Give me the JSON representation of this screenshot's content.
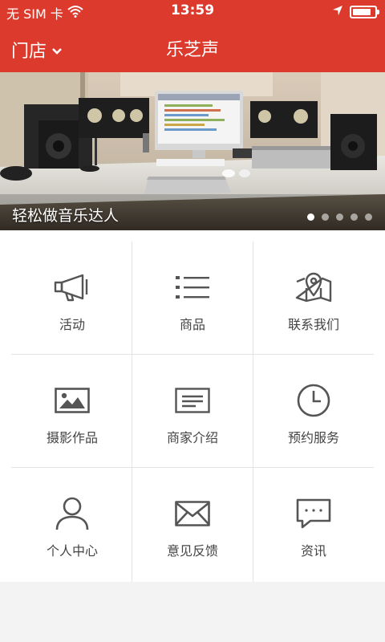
{
  "status_bar": {
    "carrier": "无 SIM 卡",
    "time": "13:59",
    "battery_level": 0.85
  },
  "nav": {
    "store_label": "门店",
    "title": "乐芝声"
  },
  "banner": {
    "caption": "轻松做音乐达人",
    "slide_count": 5,
    "active_index": 0
  },
  "menu": [
    {
      "label": "活动",
      "icon": "megaphone-icon"
    },
    {
      "label": "商品",
      "icon": "list-icon"
    },
    {
      "label": "联系我们",
      "icon": "map-pin-icon"
    },
    {
      "label": "摄影作品",
      "icon": "image-icon"
    },
    {
      "label": "商家介绍",
      "icon": "id-card-icon"
    },
    {
      "label": "预约服务",
      "icon": "clock-icon"
    },
    {
      "label": "个人中心",
      "icon": "user-icon"
    },
    {
      "label": "意见反馈",
      "icon": "envelope-icon"
    },
    {
      "label": "资讯",
      "icon": "chat-bubble-icon"
    }
  ],
  "colors": {
    "brand_red": "#dc3a2c",
    "icon_gray": "#555555",
    "divider": "#e4e4e4"
  }
}
